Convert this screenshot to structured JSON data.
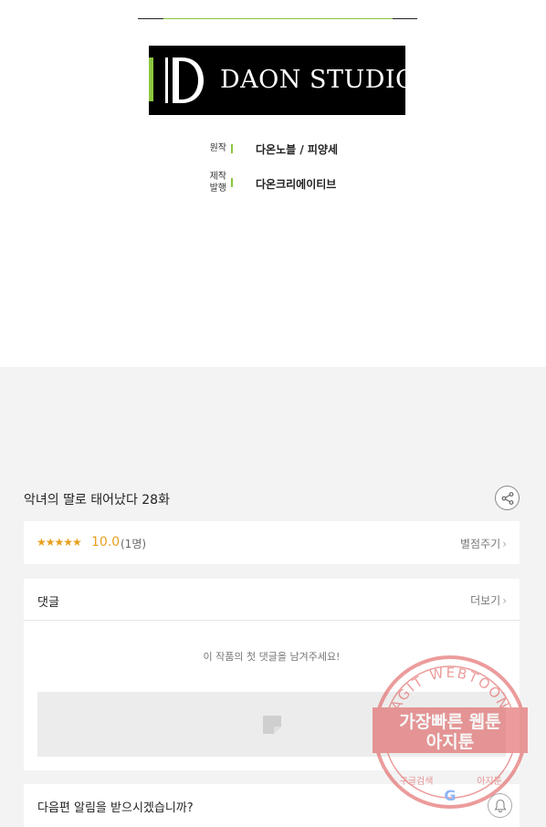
{
  "studio": {
    "logo_text": "DAON STUDIO",
    "logo_letter": "D",
    "brand_green": "#8cc63f"
  },
  "credits": [
    {
      "label": "원작",
      "value": "다온노블 / 피양세"
    },
    {
      "label": "제작\n발행",
      "value": "다온크리에이티브"
    }
  ],
  "episode": {
    "title": "악녀의 딸로 태어났다 28화",
    "share_icon": "share-icon"
  },
  "rating": {
    "stars": "★★★★★",
    "score": "10.0",
    "count": "(1명)",
    "rate_label": "별점주기",
    "accent": "#e8a01e"
  },
  "comments": {
    "title": "댓글",
    "more_label": "더보기",
    "empty_message": "이 작품의 첫 댓글을 남겨주세요!"
  },
  "notify": {
    "question": "다음편 알림을 받으시겠습니까?",
    "icon": "bell-icon"
  },
  "watermark": {
    "arc_text": "AGIT WEBTOON",
    "line1": "가장빠른 웹툰",
    "line2": "아지툰",
    "bottom_left": "구글검색",
    "bottom_right": "아지툰",
    "color": "#e05a5a"
  }
}
